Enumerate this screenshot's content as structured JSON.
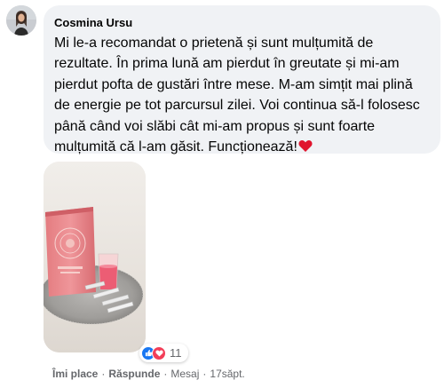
{
  "comment": {
    "author": "Cosmina Ursu",
    "text": "Mi le-a recomandat o prietenă și sunt mulțumită de rezultate. În prima lună am pierdut în greutate și mi-am pierdut pofta de gustări între mese. M-am simțit mai plină de energie pe tot parcursul zilei. Voi continua să-l folosesc până când voi slăbi cât mi-am propus și sunt foarte mulțumită că l-am găsit. Funcționează!",
    "reaction_count": "11",
    "reactions": [
      "like-icon",
      "love-icon"
    ]
  },
  "actions": {
    "like": "Îmi place",
    "reply": "Răspunde",
    "message": "Mesaj",
    "time": "17săpt."
  },
  "colors": {
    "bubble": "#f0f2f5",
    "like": "#1877f2",
    "love": "#f33e58",
    "meta": "#65676b"
  }
}
